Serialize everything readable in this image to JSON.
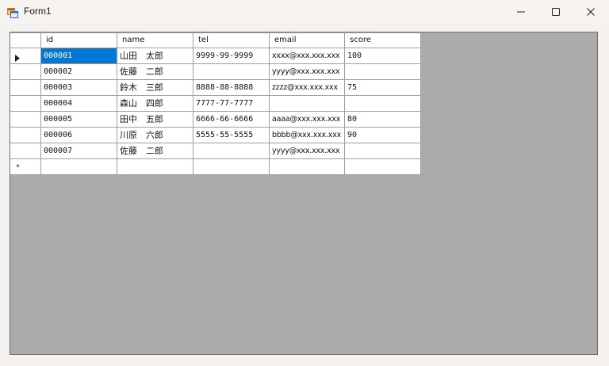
{
  "window": {
    "title": "Form1"
  },
  "grid": {
    "columns": [
      "id",
      "name",
      "tel",
      "email",
      "score"
    ],
    "rows": [
      [
        "000001",
        "山田　太郎",
        "9999-99-9999",
        "xxxx@xxx.xxx.xxx",
        "100"
      ],
      [
        "000002",
        "佐藤　二郎",
        "",
        "yyyy@xxx.xxx.xxx",
        ""
      ],
      [
        "000003",
        "鈴木　三郎",
        "8888-88-8888",
        "zzzz@xxx.xxx.xxx",
        "75"
      ],
      [
        "000004",
        "森山　四郎",
        "7777-77-7777",
        "",
        ""
      ],
      [
        "000005",
        "田中　五郎",
        "6666-66-6666",
        "aaaa@xxx.xxx.xxx",
        "80"
      ],
      [
        "000006",
        "川原　六郎",
        "5555-55-5555",
        "bbbb@xxx.xxx.xxx",
        "90"
      ],
      [
        "000007",
        "佐藤　二郎",
        "",
        "yyyy@xxx.xxx.xxx",
        ""
      ]
    ],
    "new_row_marker": "*",
    "current_row": 0,
    "selected_column": 0
  },
  "colors": {
    "selection": "#0078d7",
    "client_background": "#ababab"
  }
}
